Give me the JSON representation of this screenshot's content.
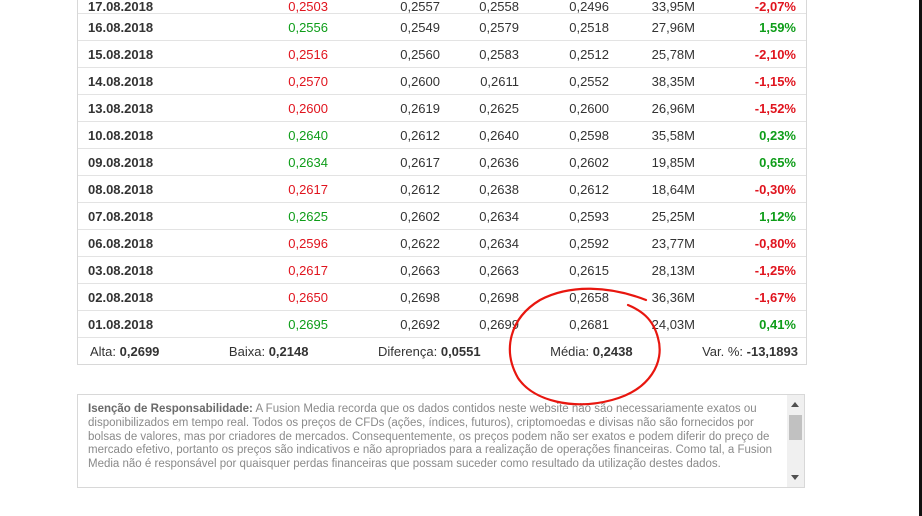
{
  "rows": [
    {
      "date": "17.08.2018",
      "close": "0,2503",
      "dir": "down",
      "open": "0,2557",
      "high": "0,2558",
      "low": "0,2496",
      "vol": "33,95M",
      "chg": "-2,07%"
    },
    {
      "date": "16.08.2018",
      "close": "0,2556",
      "dir": "up",
      "open": "0,2549",
      "high": "0,2579",
      "low": "0,2518",
      "vol": "27,96M",
      "chg": "1,59%"
    },
    {
      "date": "15.08.2018",
      "close": "0,2516",
      "dir": "down",
      "open": "0,2560",
      "high": "0,2583",
      "low": "0,2512",
      "vol": "25,78M",
      "chg": "-2,10%"
    },
    {
      "date": "14.08.2018",
      "close": "0,2570",
      "dir": "down",
      "open": "0,2600",
      "high": "0,2611",
      "low": "0,2552",
      "vol": "38,35M",
      "chg": "-1,15%"
    },
    {
      "date": "13.08.2018",
      "close": "0,2600",
      "dir": "down",
      "open": "0,2619",
      "high": "0,2625",
      "low": "0,2600",
      "vol": "26,96M",
      "chg": "-1,52%"
    },
    {
      "date": "10.08.2018",
      "close": "0,2640",
      "dir": "up",
      "open": "0,2612",
      "high": "0,2640",
      "low": "0,2598",
      "vol": "35,58M",
      "chg": "0,23%"
    },
    {
      "date": "09.08.2018",
      "close": "0,2634",
      "dir": "up",
      "open": "0,2617",
      "high": "0,2636",
      "low": "0,2602",
      "vol": "19,85M",
      "chg": "0,65%"
    },
    {
      "date": "08.08.2018",
      "close": "0,2617",
      "dir": "down",
      "open": "0,2612",
      "high": "0,2638",
      "low": "0,2612",
      "vol": "18,64M",
      "chg": "-0,30%"
    },
    {
      "date": "07.08.2018",
      "close": "0,2625",
      "dir": "up",
      "open": "0,2602",
      "high": "0,2634",
      "low": "0,2593",
      "vol": "25,25M",
      "chg": "1,12%"
    },
    {
      "date": "06.08.2018",
      "close": "0,2596",
      "dir": "down",
      "open": "0,2622",
      "high": "0,2634",
      "low": "0,2592",
      "vol": "23,77M",
      "chg": "-0,80%"
    },
    {
      "date": "03.08.2018",
      "close": "0,2617",
      "dir": "down",
      "open": "0,2663",
      "high": "0,2663",
      "low": "0,2615",
      "vol": "28,13M",
      "chg": "-1,25%"
    },
    {
      "date": "02.08.2018",
      "close": "0,2650",
      "dir": "down",
      "open": "0,2698",
      "high": "0,2698",
      "low": "0,2658",
      "vol": "36,36M",
      "chg": "-1,67%"
    },
    {
      "date": "01.08.2018",
      "close": "0,2695",
      "dir": "up",
      "open": "0,2692",
      "high": "0,2699",
      "low": "0,2681",
      "vol": "24,03M",
      "chg": "0,41%"
    }
  ],
  "summary": {
    "high_label": "Alta:",
    "high_value": "0,2699",
    "low_label": "Baixa:",
    "low_value": "0,2148",
    "diff_label": "Diferença:",
    "diff_value": "0,0551",
    "avg_label": "Média:",
    "avg_value": "0,2438",
    "var_label": "Var. %:",
    "var_value": "-13,1893"
  },
  "disclaimer": {
    "title": "Isenção de Responsabilidade:",
    "text": "A Fusion Media recorda que os dados contidos neste website não são necessariamente exatos ou disponibilizados em tempo real. Todos os preços de CFDs (ações, índices, futuros), criptomoedas e divisas não são fornecidos por bolsas de valores, mas por criadores de mercados. Consequentemente, os preços podem não ser exatos e podem diferir do preço de mercado efetivo, portanto os preços são indicativos e não apropriados para a realização de operações financeiras. Como tal, a Fusion Media não é responsável por quaisquer perdas financeiras que possam suceder como resultado da utilização destes dados."
  },
  "colors": {
    "up": "#0e9d19",
    "down": "#e0141e",
    "annotation": "#e8160f"
  },
  "icons": {
    "scroll_up": "scroll-up-arrow-icon",
    "scroll_down": "scroll-down-arrow-icon"
  }
}
